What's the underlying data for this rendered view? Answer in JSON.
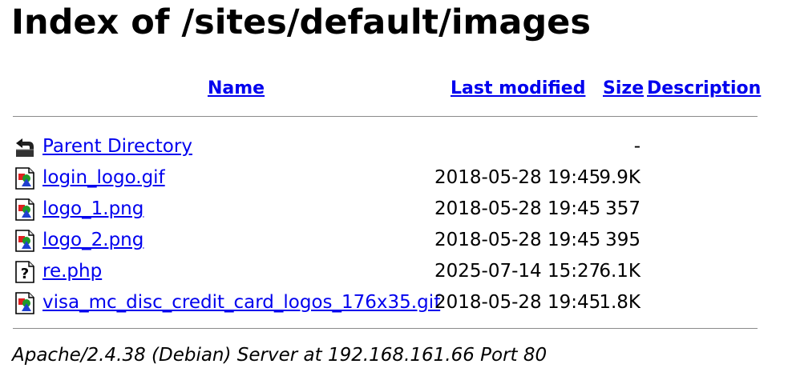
{
  "page": {
    "title": "Index of /sites/default/images"
  },
  "columns": {
    "name": "Name",
    "last_modified": "Last modified",
    "size": "Size",
    "description": "Description"
  },
  "entries": [
    {
      "icon": "parent-directory-icon",
      "name": "Parent Directory",
      "modified": "",
      "size": "-"
    },
    {
      "icon": "image-file-icon",
      "name": "login_logo.gif",
      "modified": "2018-05-28 19:45",
      "size": "9.9K"
    },
    {
      "icon": "image-file-icon",
      "name": "logo_1.png",
      "modified": "2018-05-28 19:45",
      "size": "357"
    },
    {
      "icon": "image-file-icon",
      "name": "logo_2.png",
      "modified": "2018-05-28 19:45",
      "size": "395"
    },
    {
      "icon": "unknown-file-icon",
      "name": "re.php",
      "modified": "2025-07-14 15:27",
      "size": "6.1K"
    },
    {
      "icon": "image-file-icon",
      "name": "visa_mc_disc_credit_card_logos_176x35.gif",
      "modified": "2018-05-28 19:45",
      "size": "1.8K"
    }
  ],
  "footer": {
    "signature": "Apache/2.4.38 (Debian) Server at 192.168.161.66 Port 80"
  },
  "colors": {
    "link": "#0000ee",
    "text": "#000000",
    "rule": "#8a8a8a"
  }
}
